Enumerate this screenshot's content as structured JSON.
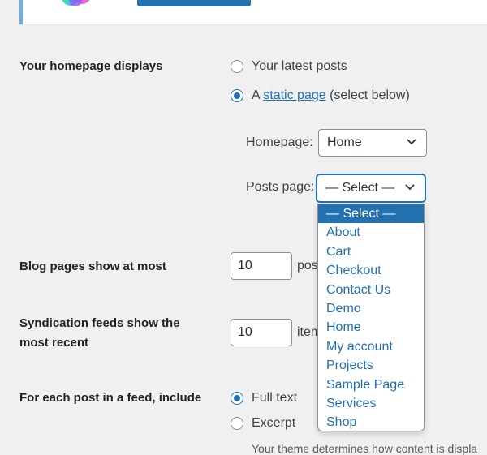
{
  "homepage_displays": {
    "label": "Your homepage displays",
    "option_latest": "Your latest posts",
    "option_static_prefix": "A",
    "option_static_link": "static page",
    "option_static_suffix": "(select below)",
    "selected": "static page"
  },
  "homepage_select": {
    "label": "Homepage:",
    "value": "Home"
  },
  "posts_page_select": {
    "label": "Posts page:",
    "value": "— Select —",
    "open": true,
    "options": [
      "— Select —",
      "About",
      "Cart",
      "Checkout",
      "Contact Us",
      "Demo",
      "Home",
      "My account",
      "Projects",
      "Sample Page",
      "Services",
      "Shop"
    ],
    "highlighted": "— Select —"
  },
  "blog_pages": {
    "label": "Blog pages show at most",
    "value": "10",
    "suffix": "pos"
  },
  "syndication": {
    "label_line1": "Syndication feeds show the",
    "label_line2": "most recent",
    "value": "10",
    "suffix": "item"
  },
  "feed_include": {
    "label": "For each post in a feed, include",
    "option_full": "Full text",
    "option_excerpt": "Excerpt",
    "selected": "Full text"
  },
  "bottom_text": "Your theme determines how content is displa",
  "colors": {
    "accent": "#2271b1",
    "background": "#f0f0f1",
    "notice_border": "#72aee6"
  }
}
